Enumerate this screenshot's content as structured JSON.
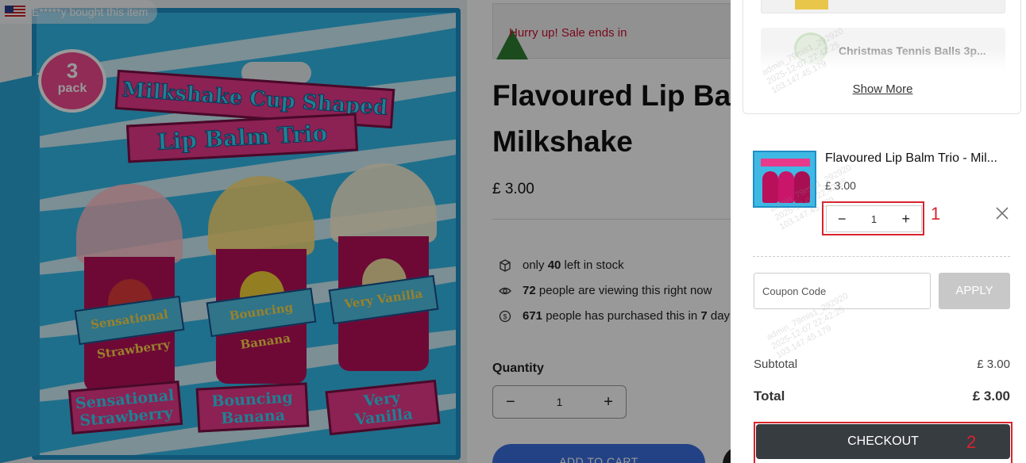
{
  "social_proof": {
    "buyer_text": "E*****y bought this item"
  },
  "product_image": {
    "badge_number": "3",
    "badge_word": "pack",
    "banner_line1": "Milkshake Cup Shaped",
    "banner_line2": "Lip Balm Trio",
    "cups": [
      {
        "label": "Sensational Strawberry",
        "bottom_line1": "Sensational",
        "bottom_line2": "Strawberry"
      },
      {
        "label": "Bouncing Banana",
        "bottom_line1": "Bouncing",
        "bottom_line2": "Banana"
      },
      {
        "label": "Very Vanilla",
        "bottom_line1": "Very",
        "bottom_line2": "Vanilla"
      }
    ]
  },
  "product": {
    "sale_text": "Hurry up!  Sale ends in",
    "title_line1": "Flavoured Lip Bal",
    "title_line2": "Milkshake",
    "price": "£ 3.00",
    "stock_prefix": "only ",
    "stock_count": "40",
    "stock_suffix": " left in stock",
    "viewing_count": "72",
    "viewing_suffix": " people are viewing this right now",
    "purchased_count": "671",
    "purchased_mid": " people has purchased this in ",
    "purchased_days": "7",
    "purchased_suffix": " day",
    "quantity_label": "Quantity",
    "quantity_value": "1",
    "add_to_cart": "ADD TO CART"
  },
  "cart": {
    "recommendation": {
      "name": "Christmas Tennis Balls 3p...",
      "show_more": "Show More"
    },
    "item": {
      "name": "Flavoured Lip Balm Trio - Mil...",
      "price": "£ 3.00",
      "quantity": "1"
    },
    "coupon_placeholder": "Coupon Code",
    "apply_label": "APPLY",
    "subtotal_label": "Subtotal",
    "subtotal_value": "£ 3.00",
    "total_label": "Total",
    "total_value": "£ 3.00",
    "checkout_label": "CHECKOUT"
  },
  "annotations": {
    "marker_1": "1",
    "marker_2": "2",
    "color": "#d9232d"
  },
  "watermark": {
    "line1": "admin_79mis1_292920",
    "line2": "2025-12-07 22:42:25",
    "line3": "103.147.45.179"
  },
  "icons": [
    "box-icon",
    "eye-icon",
    "dollar-circle-icon",
    "minus-icon",
    "plus-icon",
    "close-icon",
    "flag-icon",
    "christmas-tree-icon"
  ],
  "colors": {
    "checkout_bg": "#373c41",
    "apply_bg": "#c8c8c8",
    "sale_text": "#c8102e",
    "add_to_cart": "#3b6fe0"
  }
}
